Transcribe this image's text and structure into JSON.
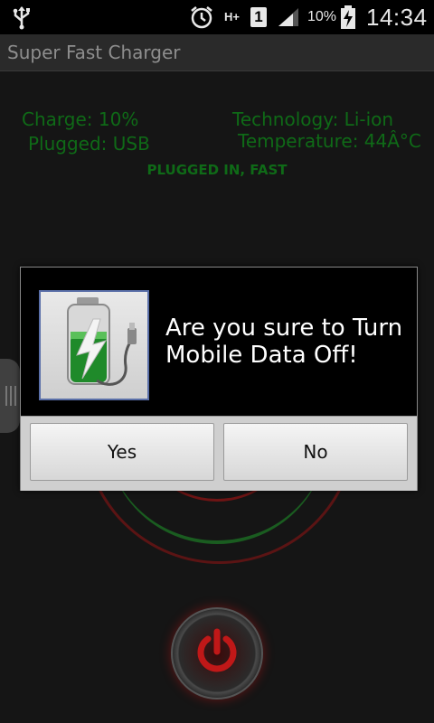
{
  "status_bar": {
    "usb_icon": "usb-icon",
    "alarm_icon": "alarm-clock-icon",
    "network_type": "H+",
    "sim_slot": "1",
    "signal_icon": "signal-icon",
    "battery_text": "10%",
    "battery_icon": "battery-charging-icon",
    "time": "14:34"
  },
  "app": {
    "title": "Super Fast Charger"
  },
  "stats": {
    "charge": "Charge: 10%",
    "plugged": "Plugged: USB",
    "technology": "Technology: Li-ion",
    "temperature": "Temperature: 44Â°C",
    "status": "PLUGGED IN, FAST"
  },
  "dialog": {
    "icon": "battery-charger-icon",
    "message": "Are you sure to Turn Mobile Data Off!",
    "yes_label": "Yes",
    "no_label": "No"
  },
  "power_button": {
    "icon": "power-icon"
  },
  "colors": {
    "stat_green": "#0f6a17",
    "background": "#151515",
    "power_red": "#b01818"
  }
}
